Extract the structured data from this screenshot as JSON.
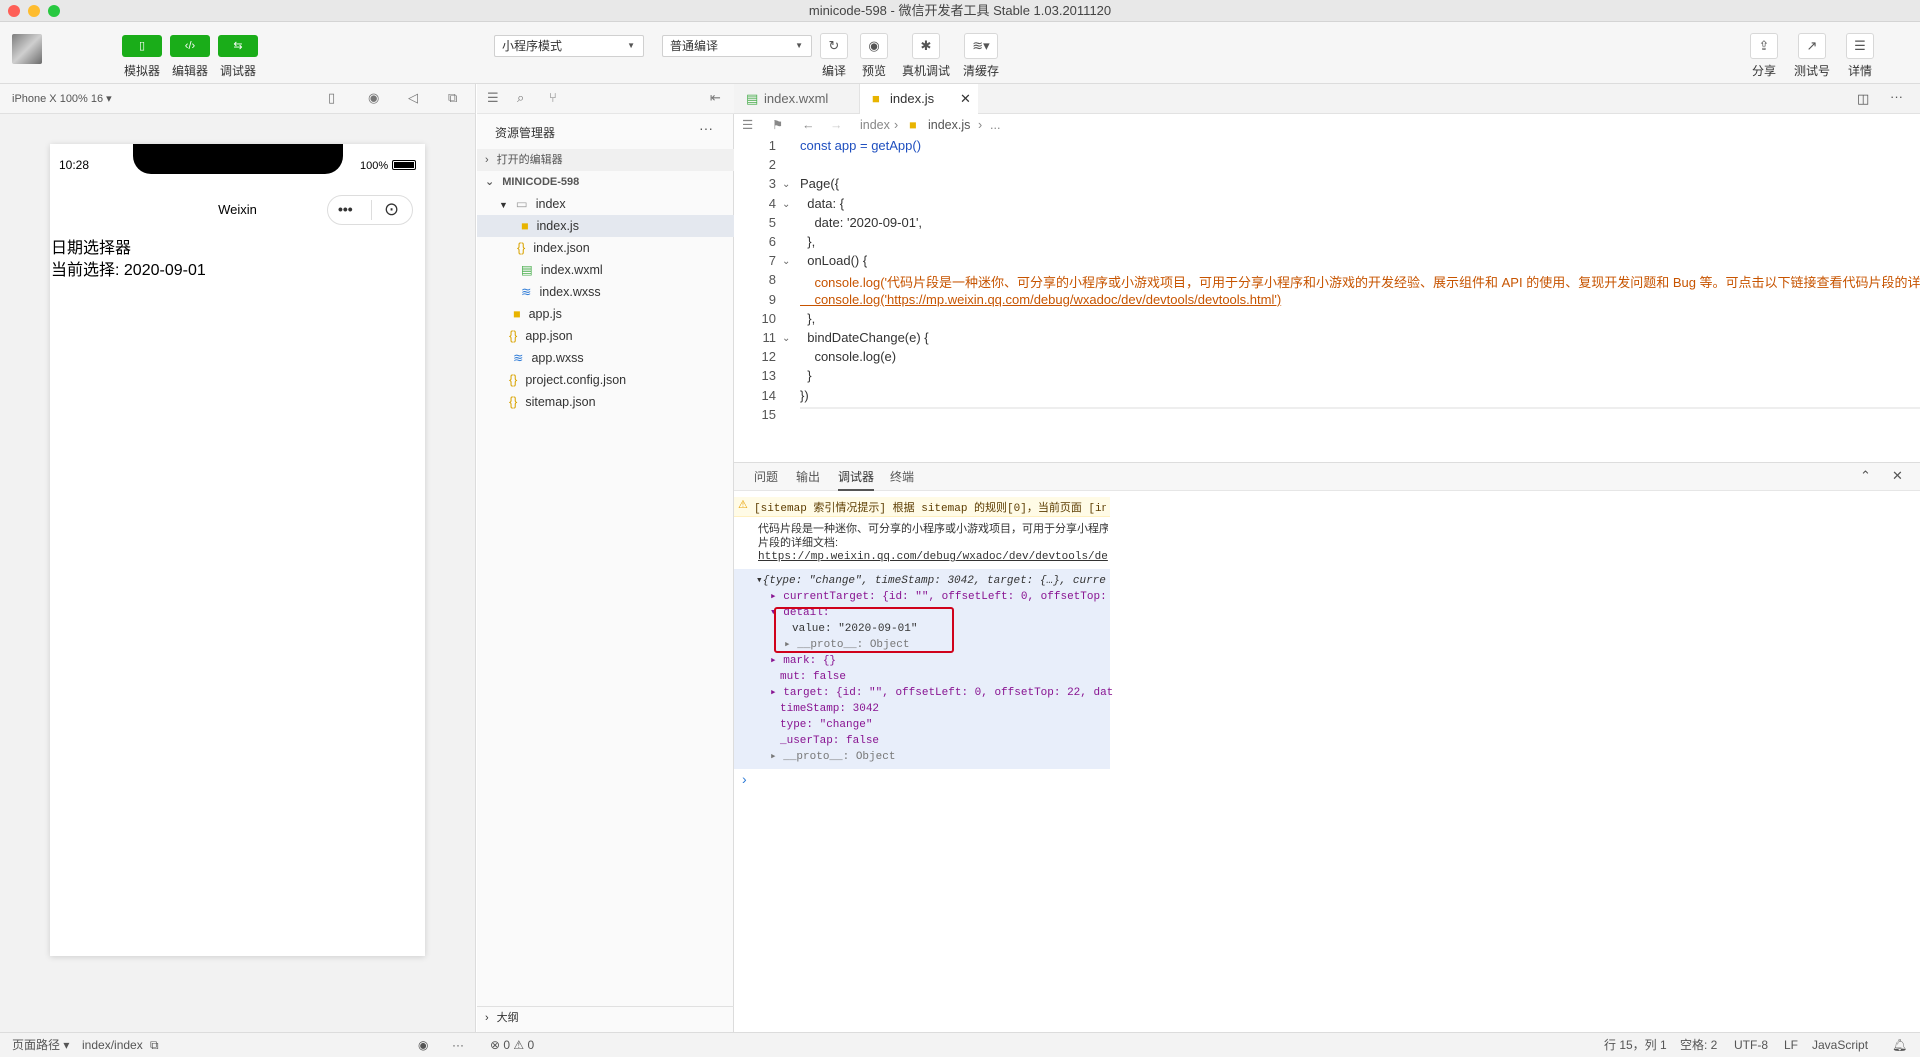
{
  "window": {
    "title": "minicode-598 - 微信开发者工具 Stable 1.03.2011120"
  },
  "toolbar": {
    "simulator": "模拟器",
    "editor": "编辑器",
    "debugger": "调试器",
    "mode_select": "小程序模式",
    "compile_select": "普通编译",
    "compile": "编译",
    "preview": "预览",
    "real_debug": "真机调试",
    "clear_cache": "清缓存",
    "share": "分享",
    "test": "测试号",
    "details": "详情"
  },
  "simulator": {
    "device": "iPhone X 100% 16 ▾",
    "time": "10:28",
    "battery": "100%",
    "nav_title": "Weixin",
    "line1": "日期选择器",
    "line2": "当前选择: 2020-09-01"
  },
  "explorer": {
    "title": "资源管理器",
    "open_editors": "打开的编辑器",
    "project": "MINICODE-598",
    "files": [
      "index",
      "index.js",
      "index.json",
      "index.wxml",
      "index.wxss",
      "app.js",
      "app.json",
      "app.wxss",
      "project.config.json",
      "sitemap.json"
    ],
    "outline": "大纲"
  },
  "editor": {
    "tabs": [
      "index.wxml",
      "index.js"
    ],
    "crumbs": [
      "index",
      "index.js",
      "..."
    ],
    "line_numbers": [
      "1",
      "2",
      "3",
      "4",
      "5",
      "6",
      "7",
      "8",
      "9",
      "10",
      "11",
      "12",
      "13",
      "14",
      "15"
    ],
    "code": [
      "const app = getApp()",
      "",
      "Page({",
      "  data: {",
      "    date: '2020-09-01',",
      "  },",
      "  onLoad() {",
      "    console.log('代码片段是一种迷你、可分享的小程序或小游戏项目，可用于分享小程序和小游戏的开发经验、展示组件和 API 的使用、复现开发问题和 Bug 等。可点击以下链接查看代码片段的详',",
      "    console.log('https://mp.weixin.qq.com/debug/wxadoc/dev/devtools/devtools.html')",
      "  },",
      "  bindDateChange(e) {",
      "    console.log(e)",
      "  }",
      "})",
      ""
    ]
  },
  "panel": {
    "tabs": [
      "问题",
      "输出",
      "调试器",
      "终端"
    ],
    "console": [
      "[sitemap 索引情况提示] 根据 sitemap 的规则[0]，当前页面 [in",
      "代码片段是一种迷你、可分享的小程序或小游戏项目，可用于分享小程序",
      "片段的详细文档:",
      "https://mp.weixin.qq.com/debug/wxadoc/dev/devtools/de",
      "▾{type: \"change\", timeStamp: 3042, target: {…}, curre",
      "▸ currentTarget: {id: \"\", offsetLeft: 0, offsetTop:",
      "▾ detail:",
      "value: \"2020-09-01\"",
      "▸ __proto__: Object",
      "▸ mark: {}",
      "mut: false",
      "▸ target: {id: \"\", offsetLeft: 0, offsetTop: 22, dat",
      "timeStamp: 3042",
      "type: \"change\"",
      "_userTap: false",
      "▸ __proto__: Object"
    ],
    "prompt": "›"
  },
  "status": {
    "page_path_label": "页面路径 ▾",
    "page_path": "index/index",
    "errors": "⊗ 0 ⚠ 0",
    "cursor": "行 15，列 1",
    "spaces": "空格: 2",
    "encoding": "UTF-8",
    "eol": "LF",
    "lang": "JavaScript"
  }
}
